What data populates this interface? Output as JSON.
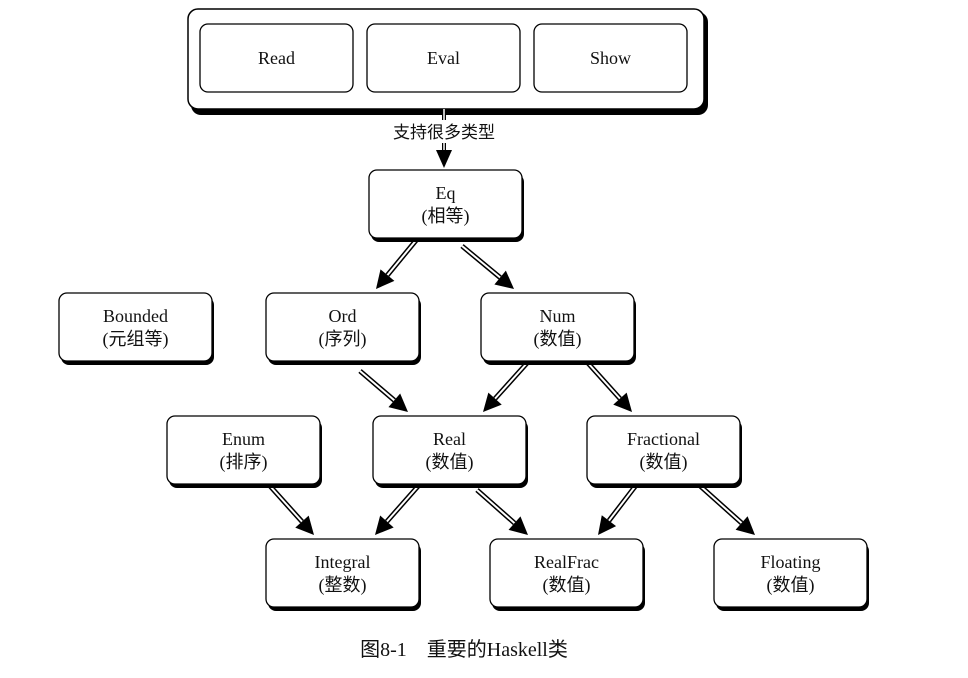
{
  "diagram": {
    "container": {
      "id": "container",
      "children": [
        {
          "id": "read",
          "label": "Read"
        },
        {
          "id": "eval",
          "label": "Eval"
        },
        {
          "id": "show",
          "label": "Show"
        }
      ]
    },
    "connector_label": "支持很多类型",
    "nodes": [
      {
        "id": "eq",
        "name": "Eq",
        "desc": "(相等)"
      },
      {
        "id": "bounded",
        "name": "Bounded",
        "desc": "(元组等)"
      },
      {
        "id": "ord",
        "name": "Ord",
        "desc": "(序列)"
      },
      {
        "id": "num",
        "name": "Num",
        "desc": "(数值)"
      },
      {
        "id": "enum",
        "name": "Enum",
        "desc": "(排序)"
      },
      {
        "id": "real",
        "name": "Real",
        "desc": "(数值)"
      },
      {
        "id": "fractional",
        "name": "Fractional",
        "desc": "(数值)"
      },
      {
        "id": "integral",
        "name": "Integral",
        "desc": "(整数)"
      },
      {
        "id": "realfrac",
        "name": "RealFrac",
        "desc": "(数值)"
      },
      {
        "id": "floating",
        "name": "Floating",
        "desc": "(数值)"
      }
    ],
    "edges": [
      {
        "from": "container",
        "to": "eq",
        "label": "支持很多类型"
      },
      {
        "from": "eq",
        "to": "ord"
      },
      {
        "from": "eq",
        "to": "num"
      },
      {
        "from": "ord",
        "to": "real"
      },
      {
        "from": "num",
        "to": "real"
      },
      {
        "from": "num",
        "to": "fractional"
      },
      {
        "from": "enum",
        "to": "integral"
      },
      {
        "from": "real",
        "to": "integral"
      },
      {
        "from": "real",
        "to": "realfrac"
      },
      {
        "from": "fractional",
        "to": "realfrac"
      },
      {
        "from": "fractional",
        "to": "floating"
      }
    ],
    "caption": "图8-1　重要的Haskell类"
  }
}
